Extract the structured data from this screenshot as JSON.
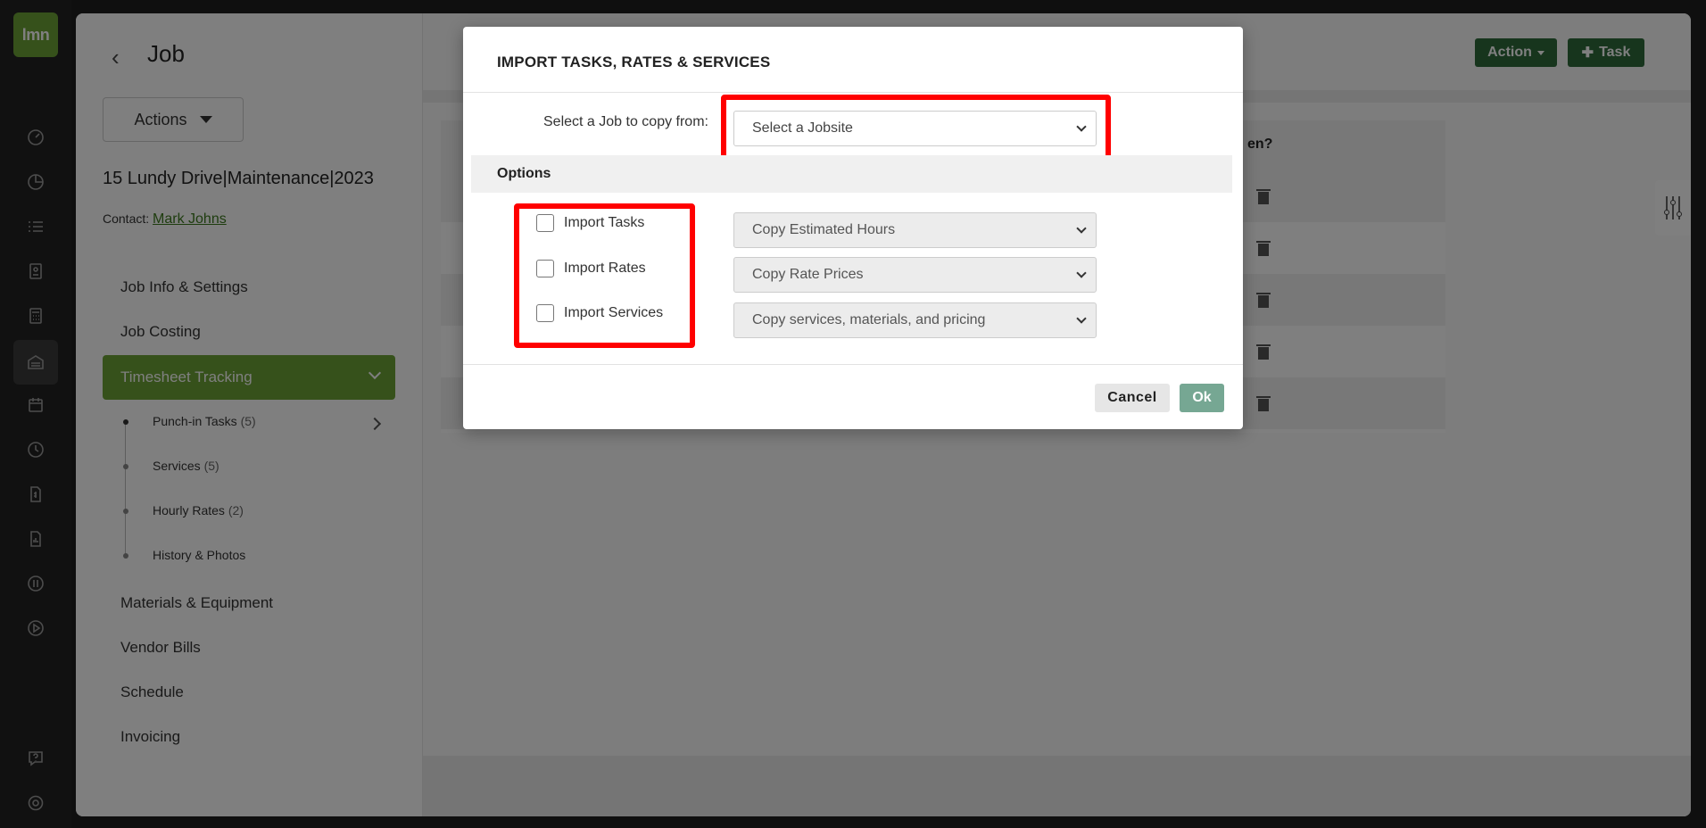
{
  "app": {
    "logo_text": "lmn"
  },
  "page": {
    "back_icon": "chevron-left-icon",
    "title": "Job",
    "actions_label": "Actions",
    "job_name": "15 Lundy Drive|Maintenance|2023",
    "contact_label": "Contact:",
    "contact_name": "Mark Johns"
  },
  "rail": {
    "icons": [
      "dashboard-icon",
      "pie-chart-icon",
      "list-icon",
      "contact-card-icon",
      "calculator-icon",
      "warehouse-icon",
      "calendar-icon",
      "clock-icon",
      "invoice-icon",
      "report-icon",
      "quickbooks-icon",
      "play-icon",
      "help-icon",
      "gear-icon"
    ]
  },
  "nav": {
    "items_top": [
      "Job Info & Settings",
      "Job Costing"
    ],
    "active": "Timesheet Tracking",
    "sub_items": [
      {
        "label": "Punch-in Tasks",
        "count": "(5)"
      },
      {
        "label": "Services",
        "count": "(5)"
      },
      {
        "label": "Hourly Rates",
        "count": "(2)"
      },
      {
        "label": "History & Photos",
        "count": ""
      }
    ],
    "items_bottom": [
      "Materials & Equipment",
      "Vendor Bills",
      "Schedule",
      "Invoicing"
    ]
  },
  "toolbar": {
    "action_label": "Action",
    "task_label": "Task"
  },
  "table": {
    "header_fragment": "en?"
  },
  "modal": {
    "title": "IMPORT TASKS, RATES & SERVICES",
    "copy_label": "Select a Job to copy from:",
    "jobsite_select": "Select a Jobsite",
    "options_label": "Options",
    "checkboxes": [
      "Import Tasks",
      "Import Rates",
      "Import Services"
    ],
    "selects": [
      "Copy Estimated Hours",
      "Copy Rate Prices",
      "Copy services, materials, and pricing"
    ],
    "cancel_label": "Cancel",
    "ok_label": "Ok"
  },
  "colors": {
    "brand_green": "#6da237",
    "dark_green": "#2e6b3a",
    "ok_green": "#76a793",
    "highlight_red": "#ff0000"
  }
}
